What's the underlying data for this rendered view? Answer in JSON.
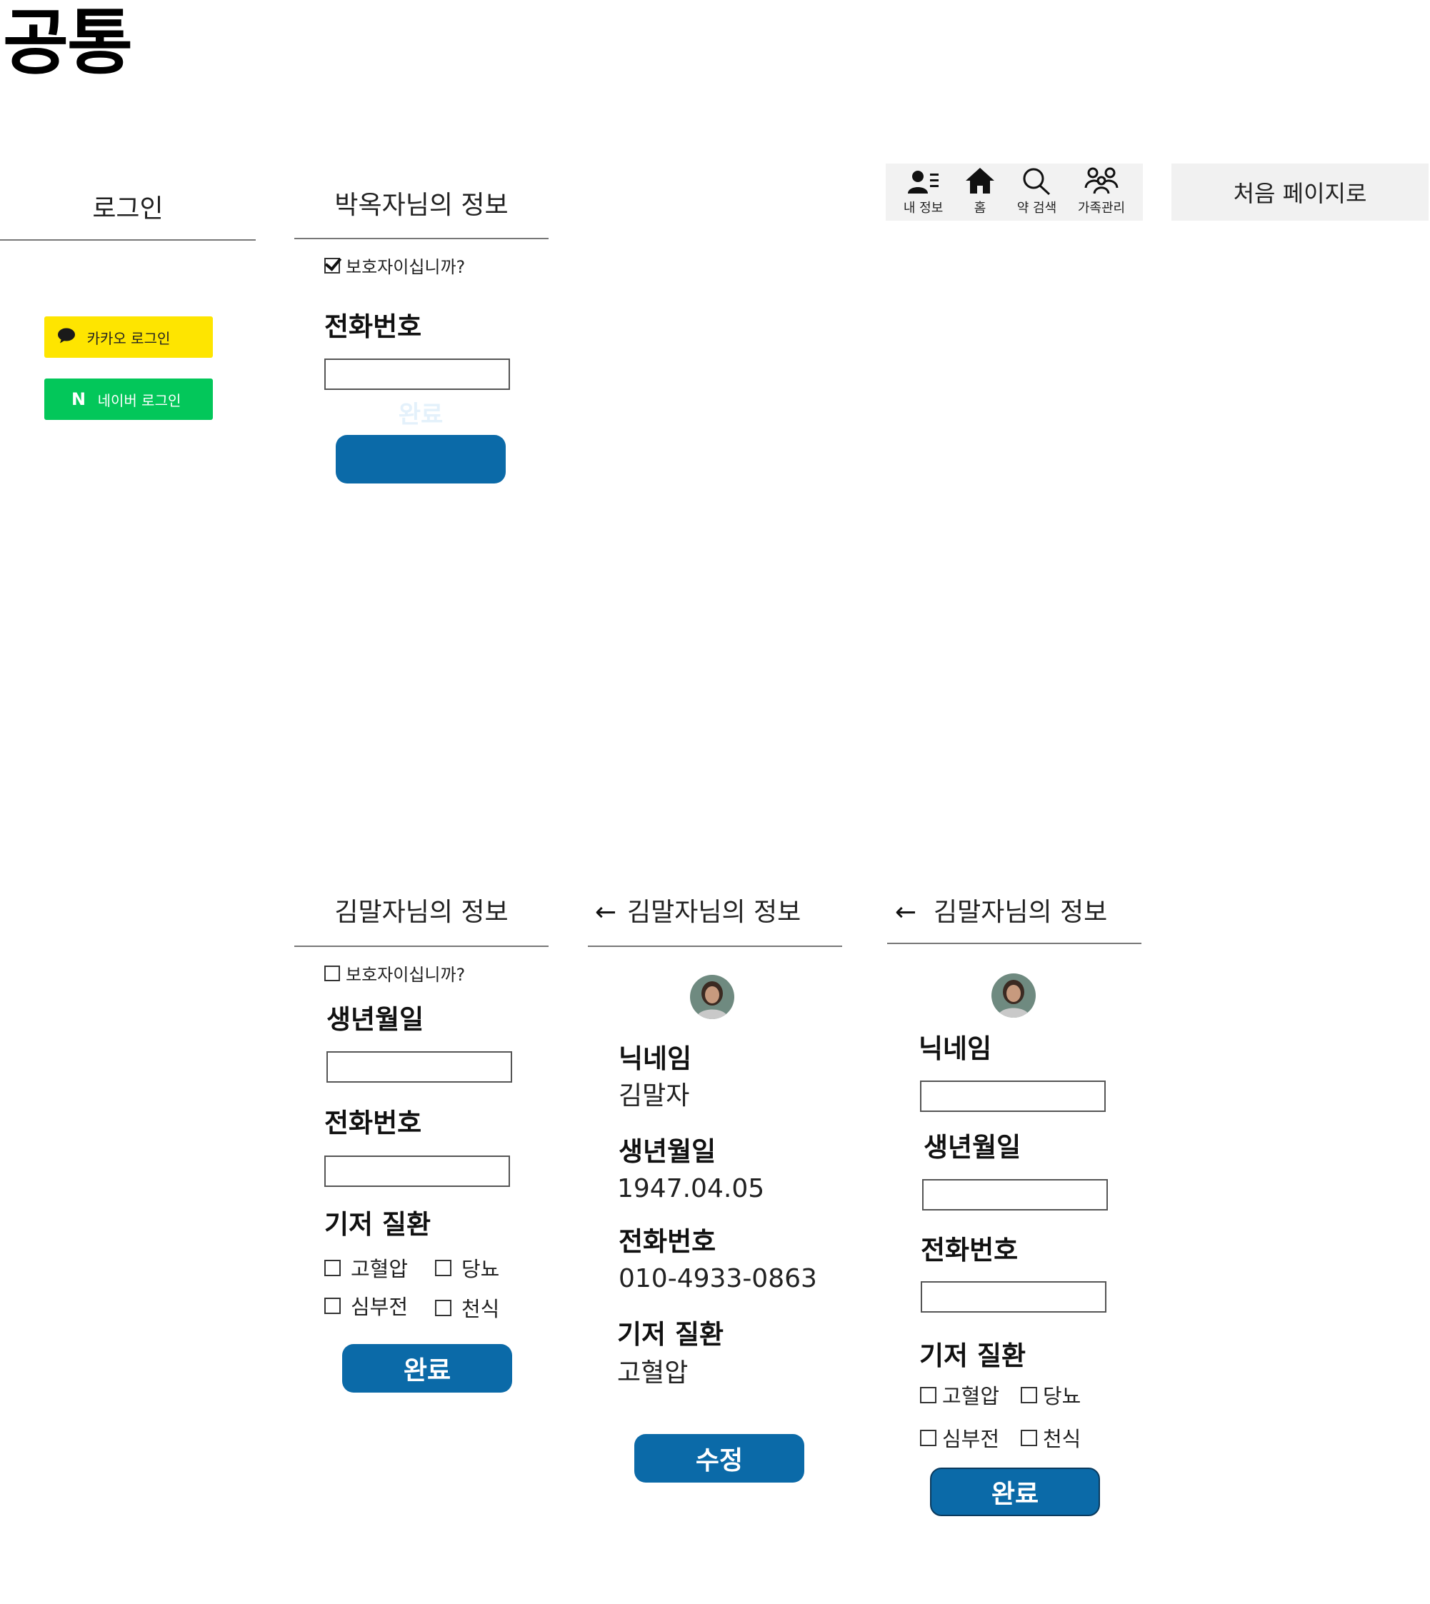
{
  "page": {
    "heading": "공통"
  },
  "login": {
    "title": "로그인",
    "kakao_label": "카카오 로그인",
    "naver_label": "네이버 로그인",
    "naver_mark": "N",
    "colors": {
      "kakao": "#fee500",
      "naver": "#03c75a"
    }
  },
  "guardian_screen": {
    "title": "박옥자님의 정보",
    "guardian_checkbox_label": "보호자이십니까?",
    "guardian_checked": true,
    "phone_label": "전화번호",
    "phone_value": "",
    "button_label": "완료"
  },
  "nav": {
    "items": [
      {
        "label": "내 정보",
        "icon": "person-list-icon"
      },
      {
        "label": "홈",
        "icon": "home-icon"
      },
      {
        "label": "약 검색",
        "icon": "search-icon"
      },
      {
        "label": "가족관리",
        "icon": "family-icon"
      }
    ],
    "start_page_label": "처음 페이지로"
  },
  "signup_screen": {
    "title": "김말자님의 정보",
    "guardian_checkbox_label": "보호자이십니까?",
    "guardian_checked": false,
    "birth_label": "생년월일",
    "phone_label": "전화번호",
    "disease_label": "기저 질환",
    "diseases": [
      "고혈압",
      "당뇨",
      "심부전",
      "천식"
    ],
    "button_label": "완료"
  },
  "profile_view": {
    "back_icon": "←",
    "title": "김말자님의 정보",
    "nickname_label": "닉네임",
    "nickname_value": "김말자",
    "birth_label": "생년월일",
    "birth_value": "1947.04.05",
    "phone_label": "전화번호",
    "phone_value": "010-4933-0863",
    "disease_label": "기저 질환",
    "disease_value": "고혈압",
    "button_label": "수정"
  },
  "profile_edit": {
    "back_icon": "←",
    "title": "김말자님의 정보",
    "nickname_label": "닉네임",
    "birth_label": "생년월일",
    "phone_label": "전화번호",
    "disease_label": "기저 질환",
    "diseases": [
      "고혈압",
      "당뇨",
      "심부전",
      "천식"
    ],
    "button_label": "완료"
  },
  "colors": {
    "primary": "#0b6aa8",
    "nav_bg": "#f2f2f2"
  }
}
